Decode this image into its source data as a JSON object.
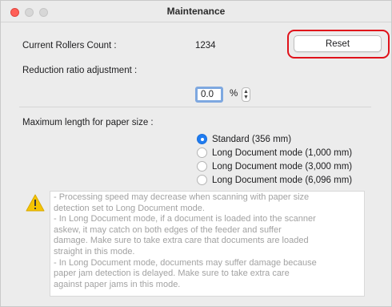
{
  "window": {
    "title": "Maintenance"
  },
  "rollers": {
    "label": "Current Rollers Count :",
    "value": "1234",
    "reset_label": "Reset"
  },
  "reduction": {
    "label": "Reduction ratio adjustment :",
    "value": "0.0",
    "unit": "%"
  },
  "paper_size": {
    "label": "Maximum length for paper size :",
    "options": [
      {
        "label": "Standard (356 mm)",
        "selected": true
      },
      {
        "label": "Long Document mode (1,000 mm)",
        "selected": false
      },
      {
        "label": "Long Document mode (3,000 mm)",
        "selected": false
      },
      {
        "label": "Long Document mode (6,096 mm)",
        "selected": false
      }
    ]
  },
  "warning": {
    "lines": [
      "- Processing speed may decrease when scanning with paper size",
      "detection set to Long Document mode.",
      "- In Long Document mode, if a document is loaded into the scanner",
      "askew, it may catch on both edges of the feeder and suffer",
      "damage. Make sure to take extra care that documents are loaded",
      "straight in this mode.",
      "- In Long Document mode, documents may suffer damage because",
      "paper jam detection is delayed. Make sure to take extra care",
      "against paper jams in this mode."
    ]
  },
  "colors": {
    "accent": "#1f7cf1",
    "highlight": "#e0121a",
    "warning_icon": "#f5c400"
  }
}
